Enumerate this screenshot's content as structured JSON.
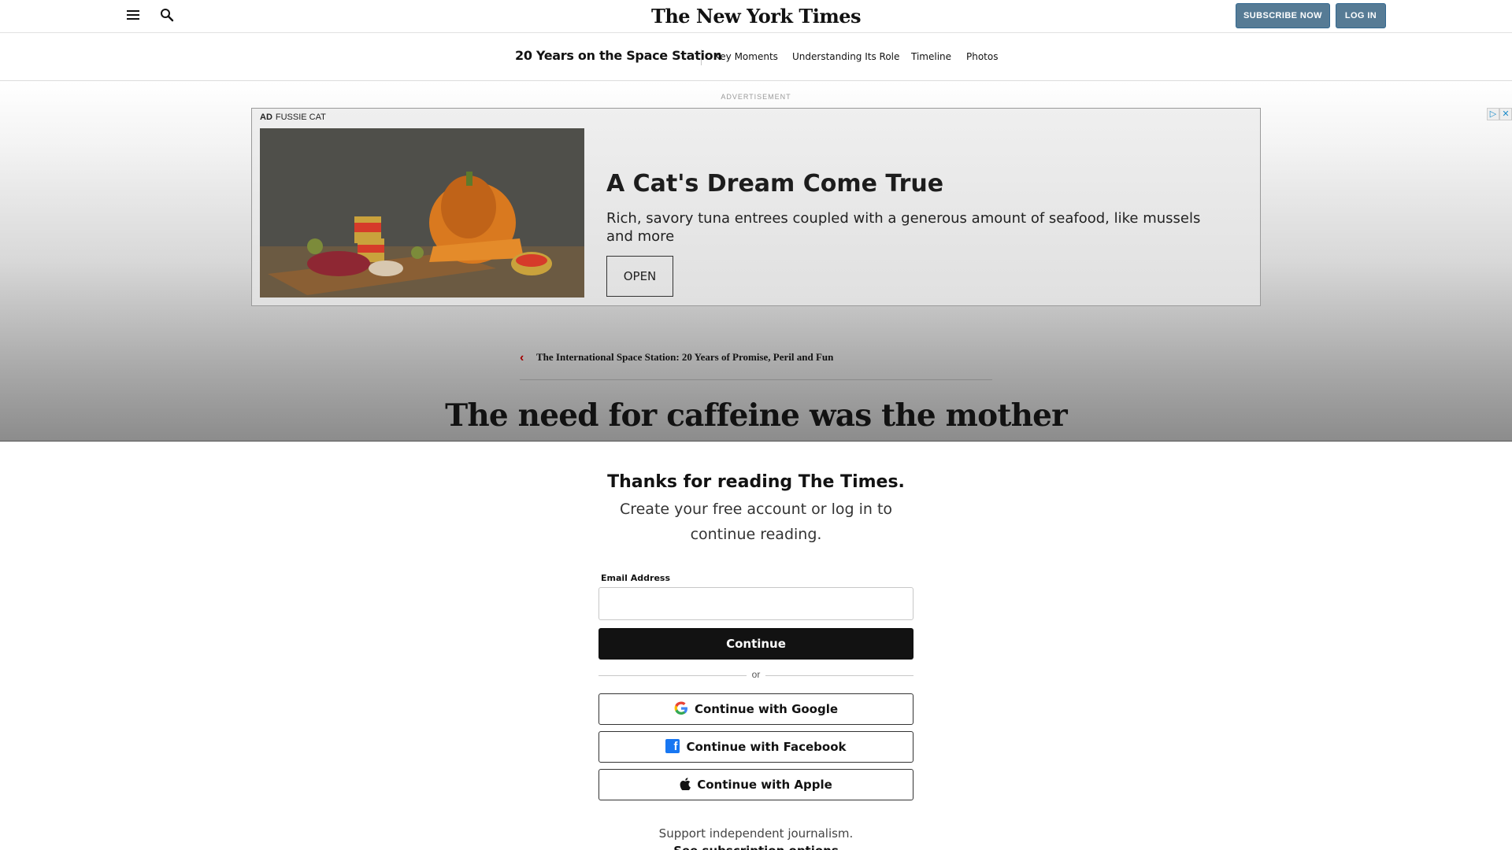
{
  "header": {
    "logo": "The New York Times",
    "subscribe_label": "SUBSCRIBE NOW",
    "login_label": "LOG IN"
  },
  "section_nav": {
    "title": "20 Years on the Space Station",
    "links": [
      "Key Moments",
      "Understanding Its Role",
      "Timeline",
      "Photos"
    ]
  },
  "ad": {
    "label": "ADVERTISEMENT",
    "tag": "AD",
    "advertiser": "FUSSIE CAT",
    "headline": "A Cat's Dream Come True",
    "body": "Rich, savory tuna entrees coupled with a generous amount of seafood, like mussels and more",
    "cta": "OPEN"
  },
  "article": {
    "back_link": "The International Space Station: 20 Years of Promise, Peril and Fun",
    "headline": "The need for caffeine was the mother"
  },
  "regwall": {
    "title": "Thanks for reading The Times.",
    "subtitle": "Create your free account or log in to continue reading.",
    "email_label": "Email Address",
    "email_value": "",
    "continue_label": "Continue",
    "or_text": "or",
    "google_label": "Continue with Google",
    "facebook_label": "Continue with Facebook",
    "apple_label": "Continue with Apple",
    "support_text": "Support independent journalism.",
    "see_options": "See subscription options"
  },
  "colors": {
    "subscribe_bg": "#567b95",
    "accent_red": "#a30000",
    "facebook_blue": "#1877f2"
  }
}
